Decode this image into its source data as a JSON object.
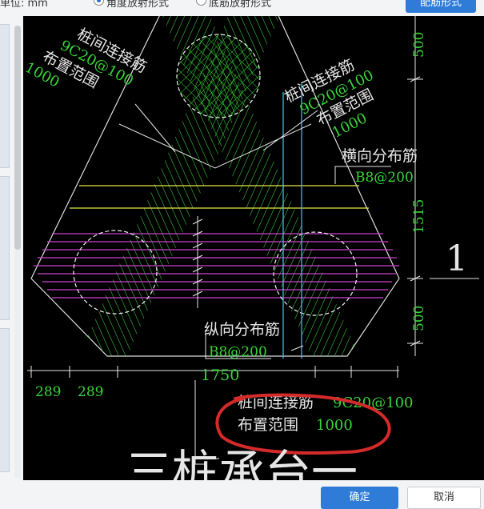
{
  "header": {
    "unit_label": "单位:  mm",
    "option_a": "角度放射形式",
    "option_b": "底筋放射形式",
    "config_button": "配筋形式"
  },
  "drawing": {
    "left_top_title": "桩间连接筋",
    "left_top_spec": "9C20@100",
    "left_range_label": "布置范围",
    "left_range_value": "1000",
    "right_top_title": "桩间连接筋",
    "right_top_spec": "9C20@100",
    "right_range_label": "布置范围",
    "right_range_value": "1000",
    "transverse_title": "横向分布筋",
    "transverse_spec": "B8@200",
    "longitudinal_title": "纵向分布筋",
    "longitudinal_spec": "B8@200",
    "bottom_title": "桩间连接筋",
    "bottom_spec": "9C20@100",
    "bottom_range_label": "布置范围",
    "bottom_range_value": "1000",
    "dim_top": "500",
    "dim_mid": "1515",
    "dim_bot": "500",
    "dim_left1": "289",
    "dim_left2": "289",
    "dim_total": "1750",
    "section_mark": "1",
    "big_title": "三桩承台一"
  },
  "footer": {
    "ok_button": "确定",
    "cancel_button": "取消"
  },
  "colors": {
    "bar_green": "#39d539",
    "distribution_yellow": "#e6e64a",
    "distribution_magenta": "#d040d0",
    "dimension_cyan": "#2ed6e6",
    "annotation_red": "#d42a2a"
  }
}
